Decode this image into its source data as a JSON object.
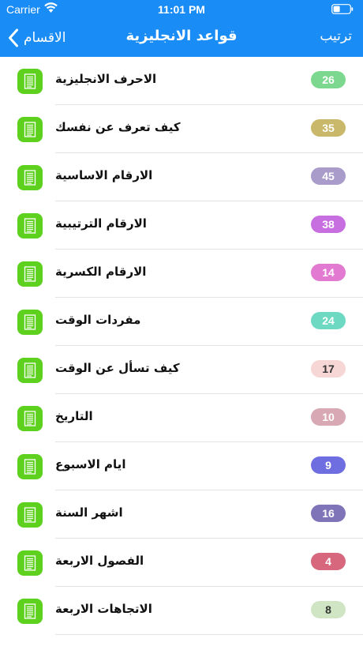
{
  "status_bar": {
    "carrier": "Carrier",
    "time": "11:01 PM"
  },
  "nav": {
    "back_label": "الاقسام",
    "title": "قواعد الانجليزية",
    "sort_label": "ترتيب"
  },
  "colors": {
    "nav_background": "#1a8cf5",
    "doc_icon_background": "#5ed11f"
  },
  "icons": {
    "wifi": "wifi-icon",
    "battery": "battery-icon",
    "back": "chevron-left-icon",
    "item": "document-icon"
  },
  "items": [
    {
      "label": "الاحرف الانجليزية",
      "count": "26",
      "badge_color": "#7dd88f",
      "text_color": "#ffffff"
    },
    {
      "label": "كيف تعرف عن نفسك",
      "count": "35",
      "badge_color": "#c9b86a",
      "text_color": "#ffffff"
    },
    {
      "label": "الارقام الاساسية",
      "count": "45",
      "badge_color": "#a99ccb",
      "text_color": "#ffffff"
    },
    {
      "label": "الارقام الترتيبية",
      "count": "38",
      "badge_color": "#c76ee0",
      "text_color": "#ffffff"
    },
    {
      "label": "الارقام الكسرية",
      "count": "14",
      "badge_color": "#e37ad1",
      "text_color": "#ffffff"
    },
    {
      "label": "مفردات الوقت",
      "count": "24",
      "badge_color": "#6ed9c3",
      "text_color": "#ffffff"
    },
    {
      "label": "كيف تسأل عن الوقت",
      "count": "17",
      "badge_color": "#f7d6d6",
      "text_color": "#333333"
    },
    {
      "label": "التاريخ",
      "count": "10",
      "badge_color": "#d8a9b5",
      "text_color": "#ffffff"
    },
    {
      "label": "ايام الاسبوع",
      "count": "9",
      "badge_color": "#6f6ee0",
      "text_color": "#ffffff"
    },
    {
      "label": "اشهر السنة",
      "count": "16",
      "badge_color": "#7f74b8",
      "text_color": "#ffffff"
    },
    {
      "label": "الفصول الاربعة",
      "count": "4",
      "badge_color": "#d6677c",
      "text_color": "#ffffff"
    },
    {
      "label": "الاتجاهات الاربعة",
      "count": "8",
      "badge_color": "#cfe5c4",
      "text_color": "#333333"
    }
  ]
}
